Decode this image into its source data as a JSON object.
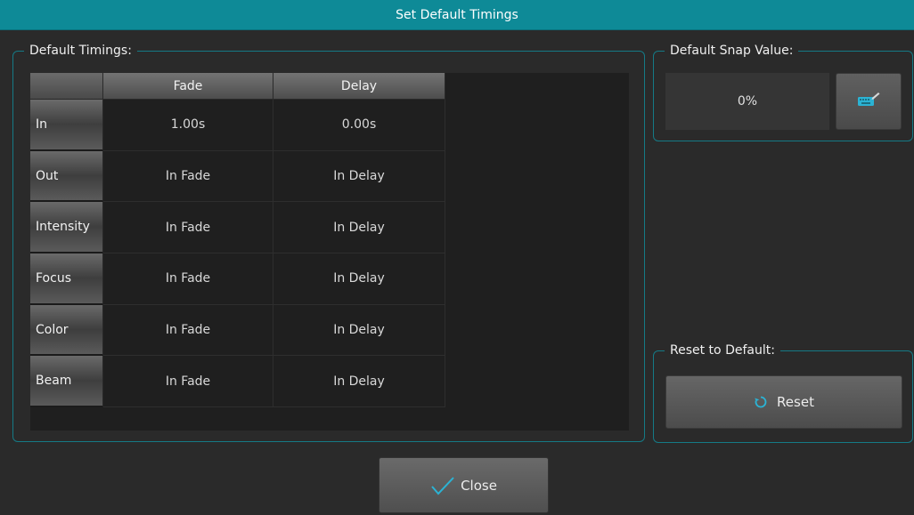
{
  "dialog": {
    "title": "Set Default Timings"
  },
  "timings": {
    "legend": "Default Timings:",
    "columns": [
      "Fade",
      "Delay"
    ],
    "rows": [
      {
        "label": "In",
        "fade": "1.00s",
        "delay": "0.00s"
      },
      {
        "label": "Out",
        "fade": "In Fade",
        "delay": "In Delay"
      },
      {
        "label": "Intensity",
        "fade": "In Fade",
        "delay": "In Delay"
      },
      {
        "label": "Focus",
        "fade": "In Fade",
        "delay": "In Delay"
      },
      {
        "label": "Color",
        "fade": "In Fade",
        "delay": "In Delay"
      },
      {
        "label": "Beam",
        "fade": "In Fade",
        "delay": "In Delay"
      }
    ]
  },
  "snap": {
    "legend": "Default Snap Value:",
    "value": "0%",
    "edit_icon": "keyboard-edit-icon"
  },
  "reset": {
    "legend": "Reset to Default:",
    "button_label": "Reset",
    "icon": "refresh-icon"
  },
  "footer": {
    "close_label": "Close",
    "close_icon": "checkmark-icon"
  },
  "colors": {
    "accent": "#0e8a97",
    "border": "#157a86",
    "icon": "#2bb3d4"
  }
}
